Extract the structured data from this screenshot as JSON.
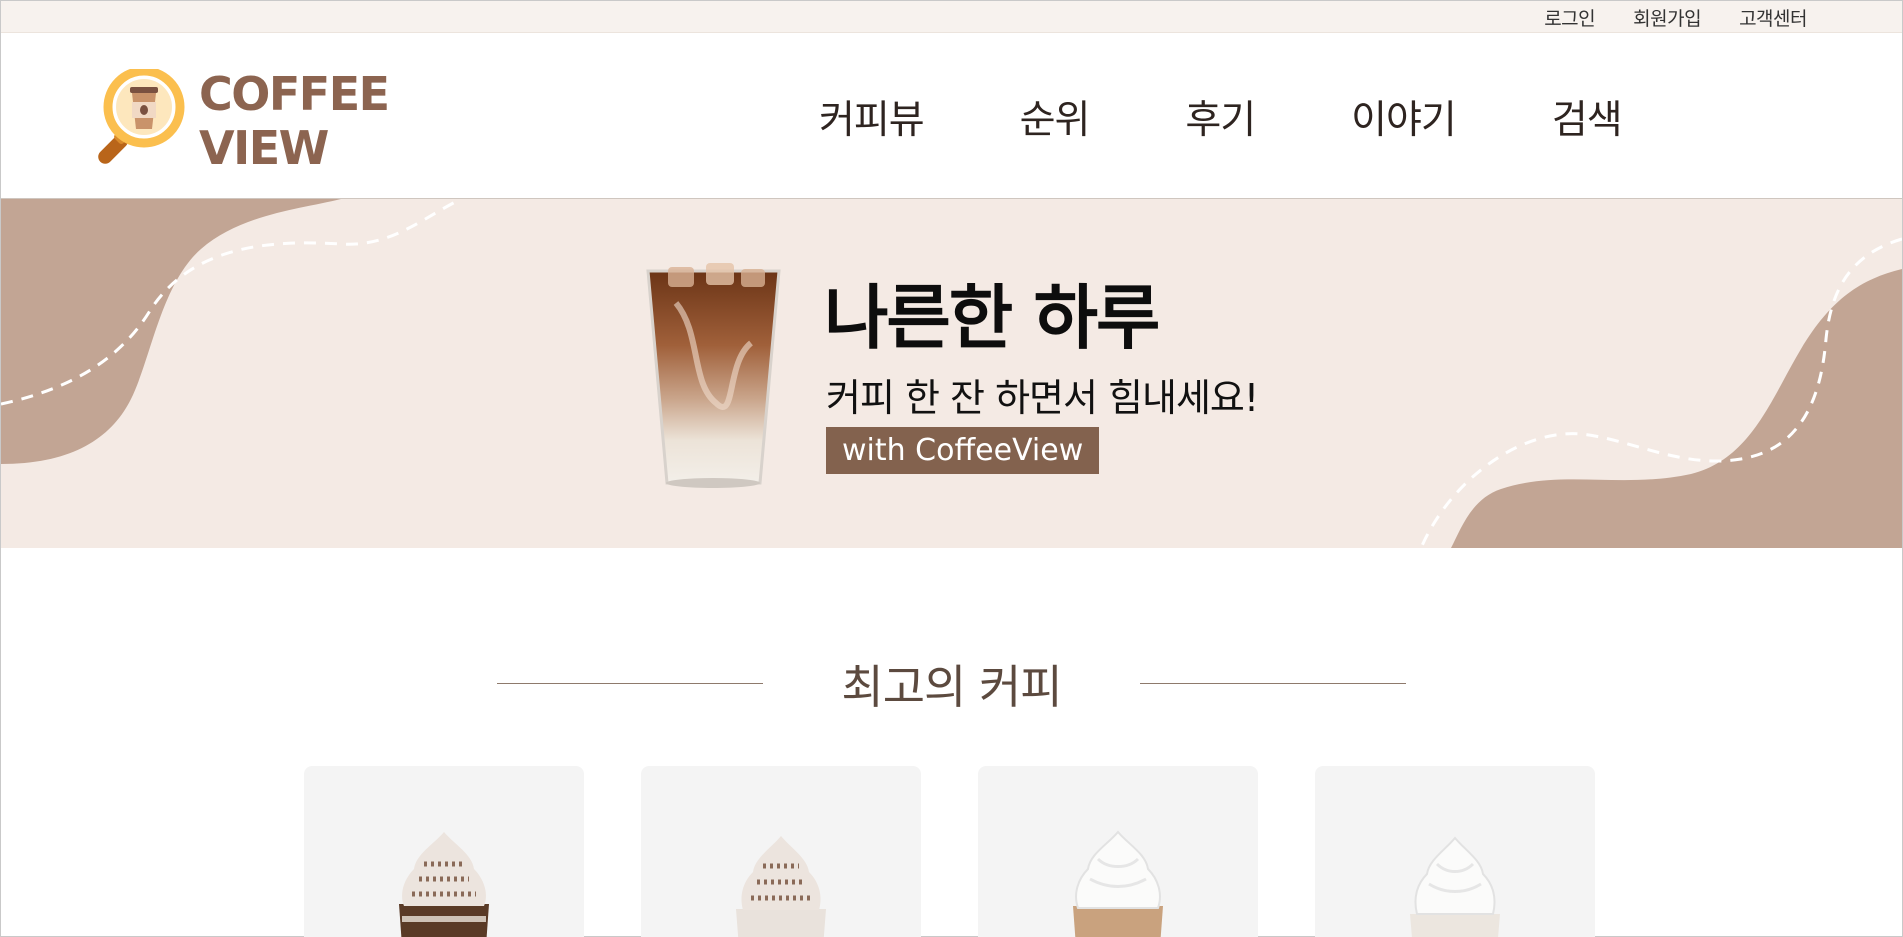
{
  "topbar": {
    "links": [
      "로그인",
      "회원가입",
      "고객센터"
    ]
  },
  "brand": {
    "line1": "COFFEE",
    "line2": "VIEW"
  },
  "nav": [
    "커피뷰",
    "순위",
    "후기",
    "이야기",
    "검색"
  ],
  "banner": {
    "headline": "나른한 하루",
    "subline": "커피 한 잔 하면서 힘내세요!",
    "tag": "with CoffeeView"
  },
  "section": {
    "title": "최고의 커피"
  },
  "colors": {
    "brand": "#8c6450",
    "banner_bg": "#f4eae4",
    "wave": "#c2a594",
    "tag_bg": "#83624e",
    "topbar_bg": "#f7f2ee"
  },
  "cards": [
    {
      "topping": "cocoa"
    },
    {
      "topping": "cocoa"
    },
    {
      "topping": "cream"
    },
    {
      "topping": "cream"
    }
  ]
}
